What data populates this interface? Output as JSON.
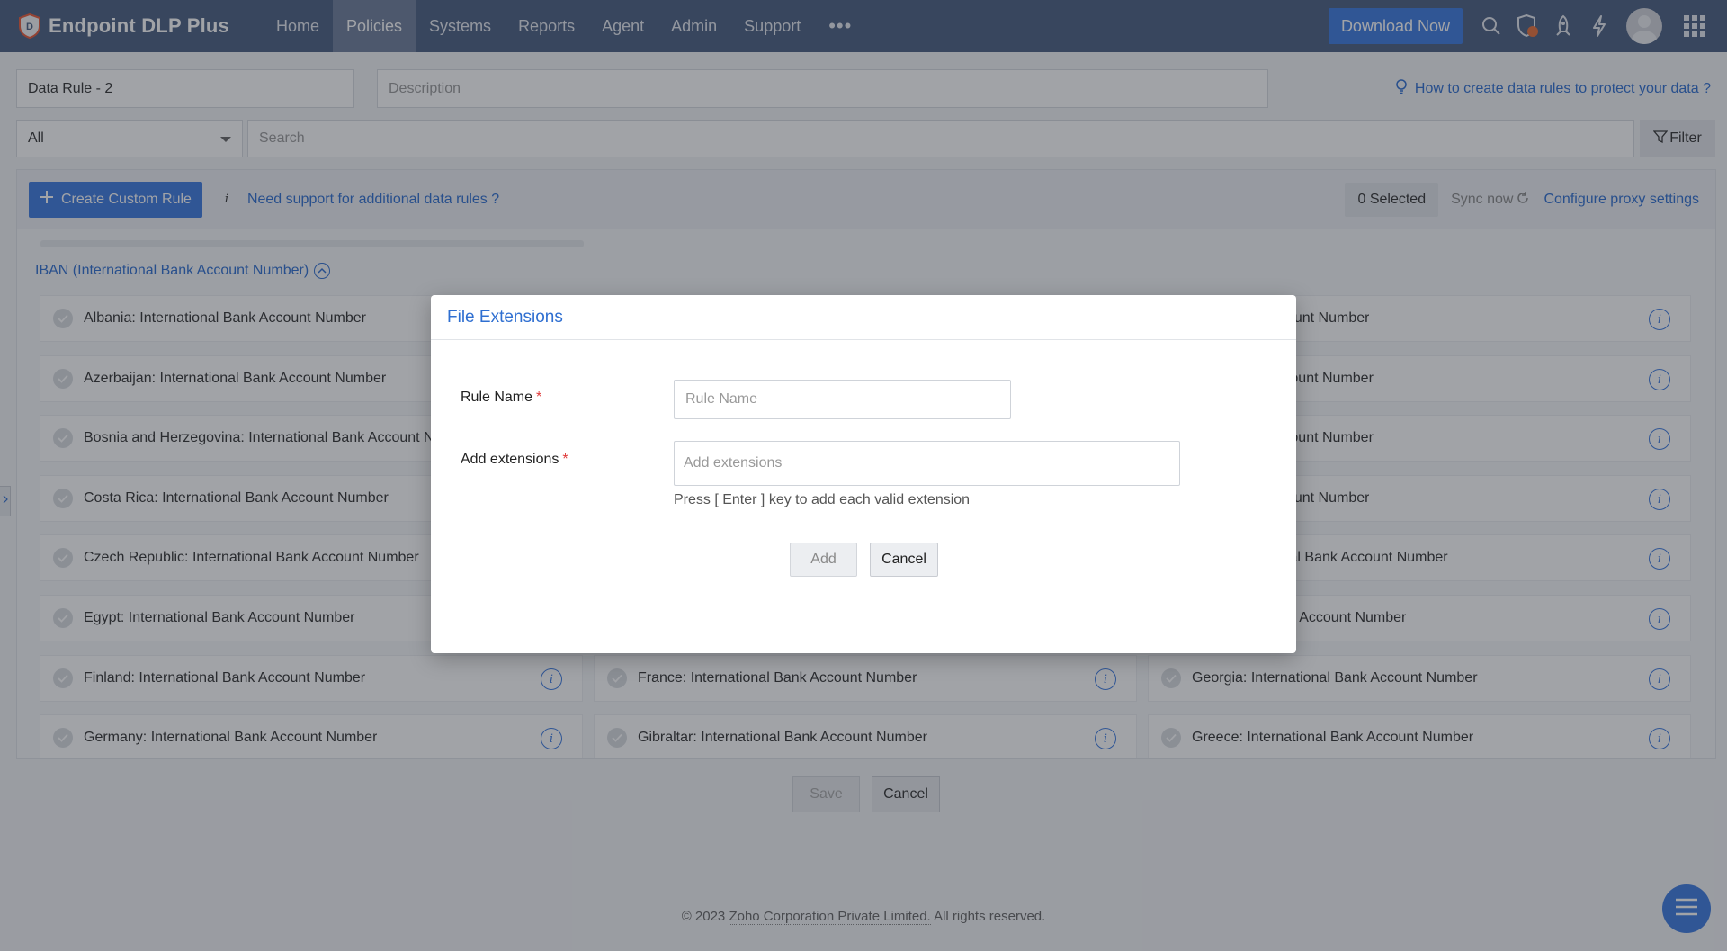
{
  "app": {
    "name": "Endpoint DLP Plus"
  },
  "nav": {
    "items": [
      {
        "label": "Home"
      },
      {
        "label": "Policies"
      },
      {
        "label": "Systems"
      },
      {
        "label": "Reports"
      },
      {
        "label": "Agent"
      },
      {
        "label": "Admin"
      },
      {
        "label": "Support"
      }
    ],
    "more": "•••",
    "download_label": "Download Now"
  },
  "form": {
    "rule_name_value": "Data Rule - 2",
    "description_placeholder": "Description",
    "help_link": "How to create data rules to protect your data ?",
    "filter_select_value": "All",
    "search_placeholder": "Search",
    "filter_label": "Filter"
  },
  "toolbar": {
    "create_label": "Create Custom Rule",
    "info_glyph": "i",
    "support_link": "Need support for additional data rules ?",
    "selected_count": "0 Selected",
    "sync_label": "Sync now",
    "proxy_link": "Configure proxy settings"
  },
  "section": {
    "title": "IBAN (International Bank Account Number)",
    "rules": [
      [
        "Albania: International Bank Account Number",
        "",
        "ional Bank Account Number"
      ],
      [
        "Azerbaijan: International Bank Account Number",
        "",
        "tional Bank Account Number"
      ],
      [
        "Bosnia and Herzegovina: International Bank Account N",
        "",
        "tional Bank Account Number"
      ],
      [
        "Costa Rica: International Bank Account Number",
        "",
        "ional Bank Account Number"
      ],
      [
        "Czech Republic: International Bank Account Number",
        "",
        "blic: International Bank Account Number"
      ],
      [
        "Egypt: International Bank Account Number",
        "",
        "ternational Bank Account Number"
      ],
      [
        "Finland: International Bank Account Number",
        "France: International Bank Account Number",
        "Georgia: International Bank Account Number"
      ],
      [
        "Germany: International Bank Account Number",
        "Gibraltar: International Bank Account Number",
        "Greece: International Bank Account Number"
      ]
    ]
  },
  "bottom": {
    "save_label": "Save",
    "cancel_label": "Cancel"
  },
  "footer": {
    "copyright": "© 2023",
    "company": "Zoho Corporation Private Limited.",
    "rights": "All rights reserved."
  },
  "modal": {
    "title": "File Extensions",
    "rule_name_label": "Rule Name",
    "rule_name_placeholder": "Rule Name",
    "extensions_label": "Add extensions",
    "extensions_placeholder": "Add extensions",
    "hint": "Press [ Enter ] key to add each valid extension",
    "add_label": "Add",
    "cancel_label": "Cancel",
    "required_mark": "*"
  },
  "colors": {
    "nav_bg": "#4b5f82",
    "accent": "#3d7ae0",
    "link": "#2f6fd1",
    "required": "#e03b3b"
  },
  "icons": [
    "dlp-logo-icon",
    "search-icon",
    "shield-alert-icon",
    "rocket-icon",
    "lightning-icon",
    "user-avatar",
    "app-grid-icon",
    "lightbulb-icon",
    "filter-icon",
    "plus-icon",
    "sync-icon",
    "chevron-up-icon",
    "check-circle-icon",
    "info-icon",
    "menu-icon"
  ]
}
